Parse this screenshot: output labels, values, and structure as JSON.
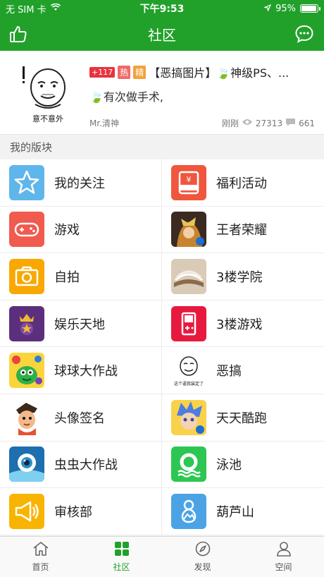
{
  "status": {
    "carrier": "无 SIM 卡",
    "time": "下午9:53",
    "battery_text": "95%",
    "battery_level": 0.95
  },
  "header": {
    "title": "社区",
    "left_icon": "thumbs-up-icon",
    "right_icon": "chat-bubble-icon"
  },
  "post": {
    "count_badge": "+117",
    "hot_badge": "热",
    "best_badge": "精",
    "title": "【恶搞图片】🍃神级PS、...",
    "subtitle": "🍃有次做手术,",
    "author": "Mr.清神",
    "time": "刚刚",
    "views": "27313",
    "comments": "661",
    "thumb_caption": "意不意外"
  },
  "section_title": "我的版块",
  "boards": [
    {
      "label": "我的关注",
      "icon": "star-icon",
      "color": "#5fb6ea"
    },
    {
      "label": "福利活动",
      "icon": "gift-bag-icon",
      "color": "#f0563e"
    },
    {
      "label": "游戏",
      "icon": "gamepad-icon",
      "color": "#f05a4f"
    },
    {
      "label": "王者荣耀",
      "icon": "hero-avatar-icon",
      "color": "#c7832f"
    },
    {
      "label": "自拍",
      "icon": "camera-icon",
      "color": "#f8a800"
    },
    {
      "label": "3楼学院",
      "icon": "book-icon",
      "color": "#b49a7c"
    },
    {
      "label": "娱乐天地",
      "icon": "crown-star-icon",
      "color": "#5b2f7e"
    },
    {
      "label": "3楼游戏",
      "icon": "handheld-console-icon",
      "color": "#e8193f"
    },
    {
      "label": "球球大作战",
      "icon": "blob-monster-icon",
      "color": "#2fb14a"
    },
    {
      "label": "恶搞",
      "icon": "meme-face-icon",
      "color": "#ffffff",
      "caption": "这个逼我装定了"
    },
    {
      "label": "头像签名",
      "icon": "cartoon-avatar-icon",
      "color": "#e9512f"
    },
    {
      "label": "天天酷跑",
      "icon": "runner-avatar-icon",
      "color": "#4d7de0"
    },
    {
      "label": "虫虫大作战",
      "icon": "eye-monster-icon",
      "color": "#2a8fc6"
    },
    {
      "label": "泳池",
      "icon": "lifebuoy-icon",
      "color": "#2dc653"
    },
    {
      "label": "审核部",
      "icon": "megaphone-icon",
      "color": "#f8b400"
    },
    {
      "label": "葫芦山",
      "icon": "gourd-mountain-icon",
      "color": "#4ba3e6"
    }
  ],
  "tabs": [
    {
      "label": "首页",
      "icon": "home-icon",
      "active": false
    },
    {
      "label": "社区",
      "icon": "grid-icon",
      "active": true
    },
    {
      "label": "发现",
      "icon": "compass-icon",
      "active": false
    },
    {
      "label": "空间",
      "icon": "person-icon",
      "active": false
    }
  ]
}
